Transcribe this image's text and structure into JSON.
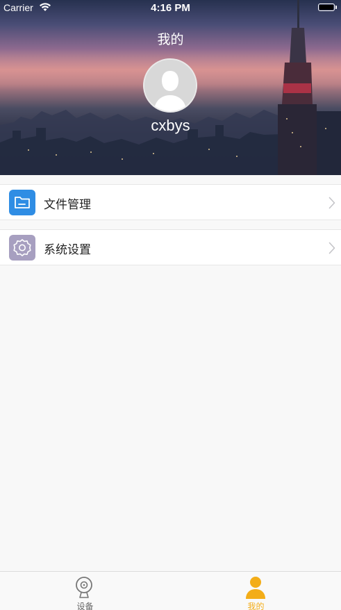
{
  "status_bar": {
    "carrier": "Carrier",
    "time": "4:16 PM"
  },
  "header": {
    "title": "我的",
    "username": "cxbys",
    "avatar_icon": "default-avatar-icon"
  },
  "menu": {
    "items": [
      {
        "label": "文件管理",
        "icon": "folder-icon",
        "icon_color": "#2f8de4"
      },
      {
        "label": "系统设置",
        "icon": "gear-icon",
        "icon_color": "#a79fc0"
      }
    ]
  },
  "tabbar": {
    "tabs": [
      {
        "label": "设备",
        "icon": "camera-icon",
        "selected": false
      },
      {
        "label": "我的",
        "icon": "person-icon",
        "selected": true
      }
    ],
    "active_color": "#f3ad18",
    "inactive_color": "#666666"
  }
}
